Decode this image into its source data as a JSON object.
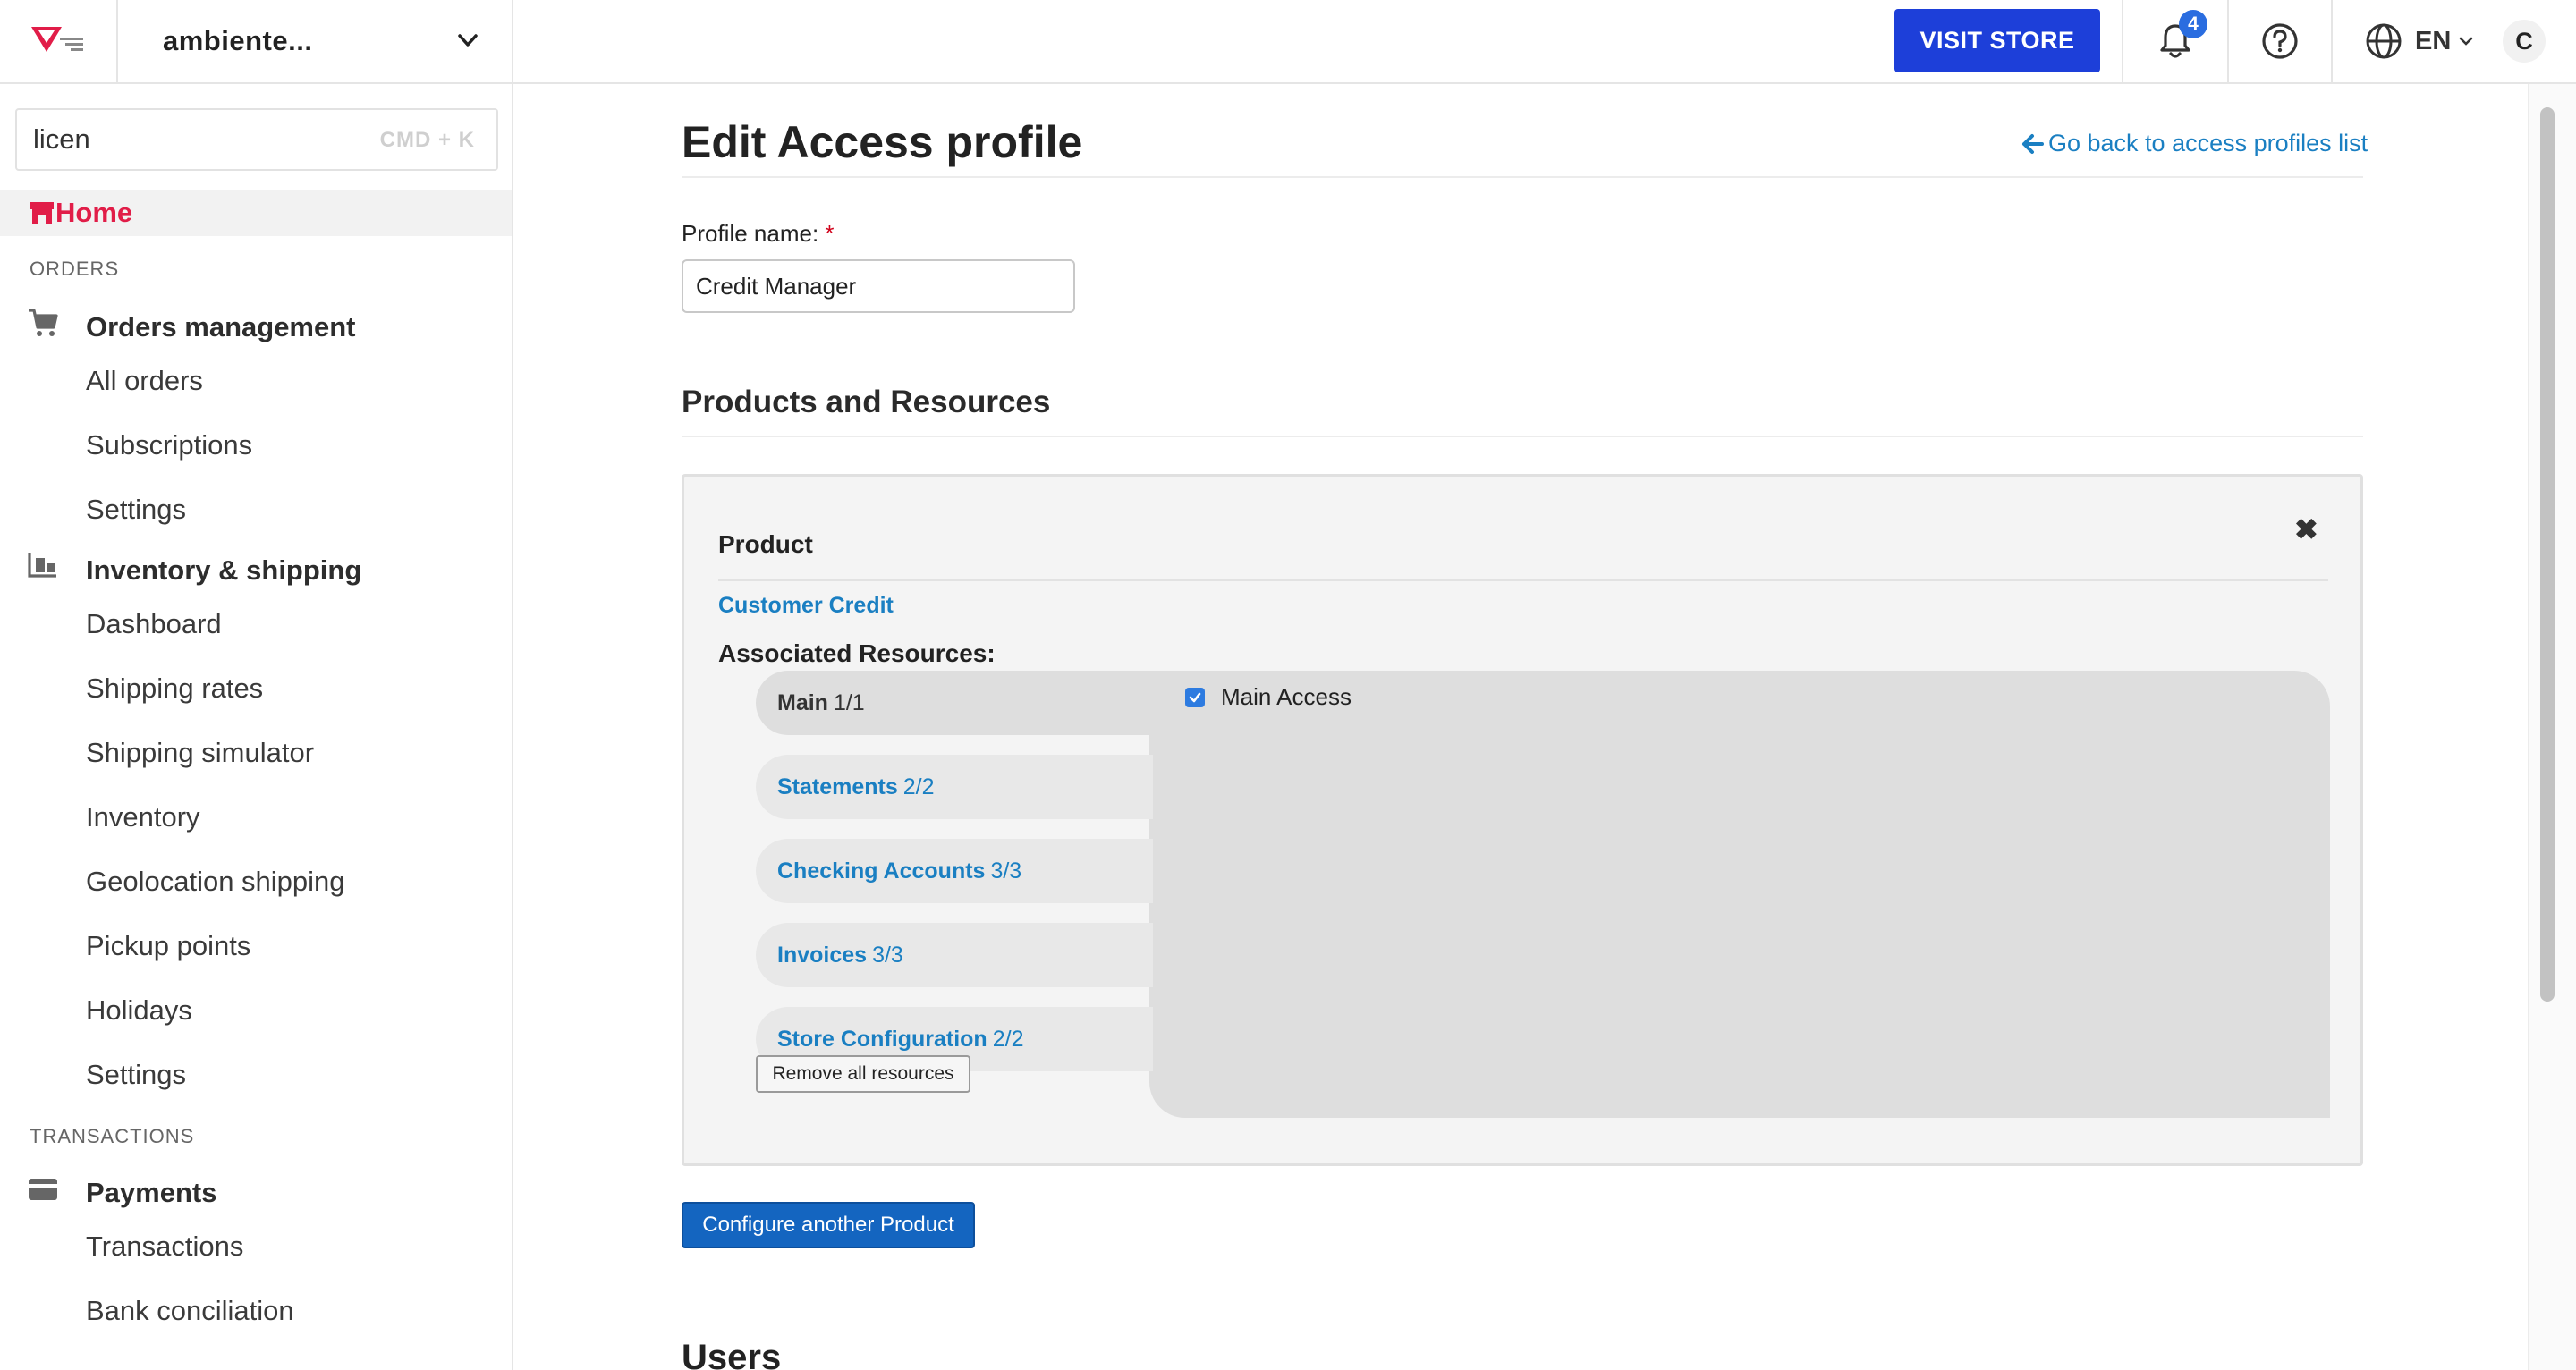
{
  "topbar": {
    "store_name": "ambiente...",
    "visit_store": "VISIT STORE",
    "notifications_count": "4",
    "language": "EN",
    "user_initial": "C"
  },
  "sidebar": {
    "search_value": "licen",
    "search_shortcut": "CMD + K",
    "home": "Home",
    "sections": {
      "orders": "ORDERS",
      "transactions": "TRANSACTIONS"
    },
    "orders_management": {
      "label": "Orders management",
      "items": [
        "All orders",
        "Subscriptions",
        "Settings"
      ]
    },
    "inventory_shipping": {
      "label": "Inventory & shipping",
      "items": [
        "Dashboard",
        "Shipping rates",
        "Shipping simulator",
        "Inventory",
        "Geolocation shipping",
        "Pickup points",
        "Holidays",
        "Settings"
      ]
    },
    "payments": {
      "label": "Payments",
      "items": [
        "Transactions",
        "Bank conciliation"
      ]
    }
  },
  "main": {
    "title": "Edit Access profile",
    "back_link": "Go back to access profiles list",
    "profile_name_label": "Profile name:",
    "required_mark": "*",
    "profile_name_value": "Credit Manager",
    "products_title": "Products and Resources",
    "product": {
      "label": "Product",
      "close": "✖",
      "name": "Customer Credit",
      "associated_label": "Associated Resources:",
      "resources": [
        {
          "name": "Main",
          "count": "1/1",
          "active": true
        },
        {
          "name": "Statements",
          "count": "2/2",
          "active": false
        },
        {
          "name": "Checking Accounts",
          "count": "3/3",
          "active": false
        },
        {
          "name": "Invoices",
          "count": "3/3",
          "active": false
        },
        {
          "name": "Store Configuration",
          "count": "2/2",
          "active": false
        }
      ],
      "main_access_label": "Main Access",
      "remove_all": "Remove all resources"
    },
    "configure_another": "Configure another Product",
    "users_title": "Users"
  },
  "colors": {
    "brand": "#e11d48",
    "accent": "#1d3fd9",
    "link": "#1a7fc2"
  }
}
